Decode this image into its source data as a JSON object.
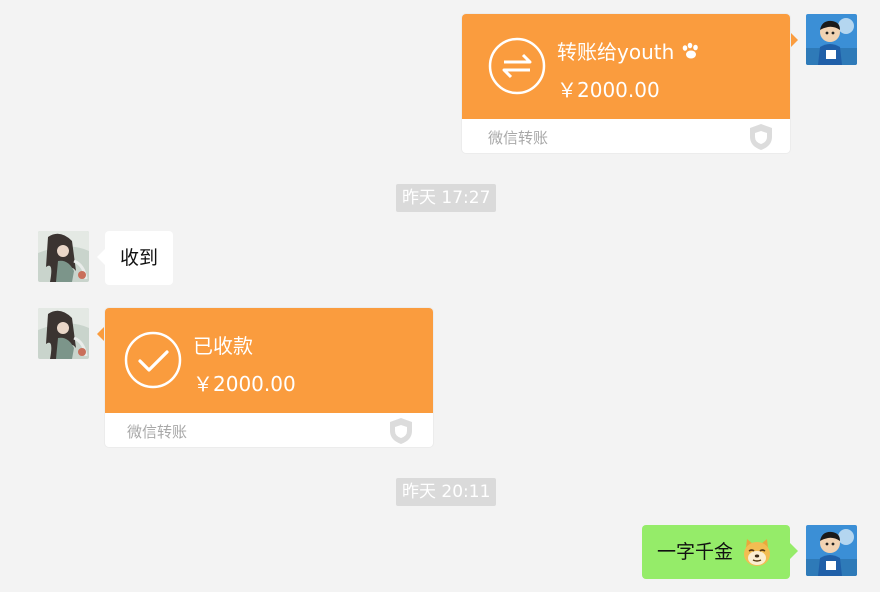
{
  "messages": {
    "sent_transfer": {
      "title": "转账给youth",
      "amount": "￥2000.00",
      "footer": "微信转账",
      "icon": "transfer-arrows-icon",
      "accent": "#fa9c3e"
    },
    "timestamp_1": "昨天 17:27",
    "received_text": "收到",
    "received_transfer": {
      "title": "已收款",
      "amount": "￥2000.00",
      "footer": "微信转账",
      "icon": "checkmark-circle-icon",
      "accent": "#fa9c3e"
    },
    "timestamp_2": "昨天 20:11",
    "sent_text": "一字千金"
  },
  "colors": {
    "background": "#f3f3f3",
    "sent_bubble": "#95ec69",
    "received_bubble": "#ffffff",
    "timestamp_bg": "#dadada"
  }
}
